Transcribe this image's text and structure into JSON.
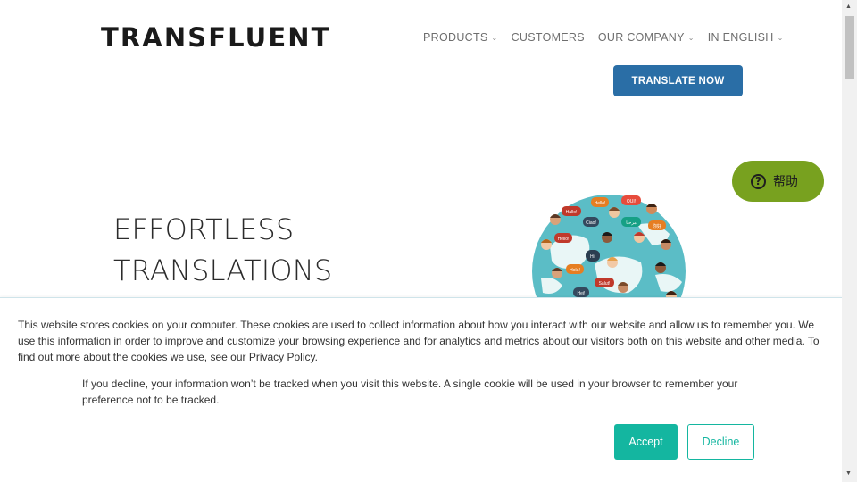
{
  "brand": {
    "logo_text": "TRANSFLUENT"
  },
  "nav": {
    "items": [
      {
        "label": "PRODUCTS",
        "has_dropdown": true
      },
      {
        "label": "CUSTOMERS",
        "has_dropdown": false
      },
      {
        "label": "OUR COMPANY",
        "has_dropdown": true
      },
      {
        "label": "IN ENGLISH",
        "has_dropdown": true
      }
    ],
    "cta_label": "TRANSLATE NOW"
  },
  "help_widget": {
    "label": "帮助",
    "icon": "question-circle-icon"
  },
  "hero": {
    "line1": "EFFORTLESS",
    "line2": "TRANSLATIONS"
  },
  "globe_bubbles": [
    "Hello!",
    "Hola!",
    "Ciao!",
    "Hi!",
    "Salut!",
    "OUI!",
    "你好",
    "مرحبا",
    "Hallo!",
    "Hej!"
  ],
  "cookie_banner": {
    "text1": "This website stores cookies on your computer. These cookies are used to collect information about how you interact with our website and allow us to remember you. We use this information in order to improve and customize your browsing experience and for analytics and metrics about our visitors both on this website and other media. To find out more about the cookies we use, see our Privacy Policy.",
    "text2": "If you decline, your information won’t be tracked when you visit this website. A single cookie will be used in your browser to remember your preference not to be tracked.",
    "accept_label": "Accept",
    "decline_label": "Decline"
  },
  "colors": {
    "cta_blue": "#2a6ea6",
    "help_green": "#78a11f",
    "accept_teal": "#14b6a0",
    "globe_teal": "#5bbdc6"
  }
}
